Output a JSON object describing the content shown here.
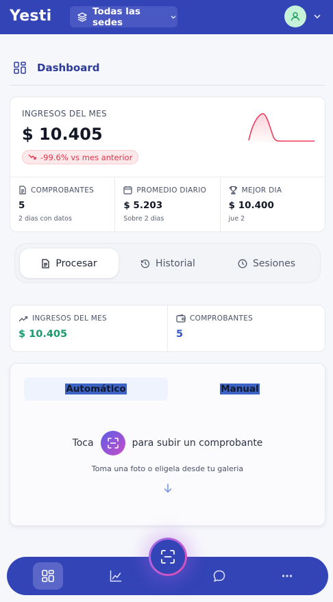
{
  "header": {
    "logo": "Yesti",
    "site_selector": "Todas las sedes"
  },
  "page": {
    "title": "Dashboard"
  },
  "income": {
    "label": "INGRESOS DEL MES",
    "value": "$ 10.405",
    "trend": "-99.6% vs mes anterior",
    "stats": [
      {
        "label": "COMPROBANTES",
        "value": "5",
        "sub": "2 dias con datos",
        "icon": "document-icon"
      },
      {
        "label": "PROMEDIO DIARIO",
        "value": "$ 5.203",
        "sub": "Sobre 2 dias",
        "icon": "calendar-icon"
      },
      {
        "label": "MEJOR DIA",
        "value": "$ 10.400",
        "sub": "jue 2",
        "icon": "trophy-icon"
      }
    ]
  },
  "tabs": [
    {
      "label": "Procesar",
      "icon": "document-icon"
    },
    {
      "label": "Historial",
      "icon": "history-icon"
    },
    {
      "label": "Sesiones",
      "icon": "clock-icon"
    }
  ],
  "mini_stats": [
    {
      "label": "INGRESOS DEL MES",
      "value": "$ 10.405",
      "color": "#1a9a6c",
      "icon": "trending-up-icon"
    },
    {
      "label": "COMPROBANTES",
      "value": "5",
      "color": "#3356c8",
      "icon": "wallet-icon"
    }
  ],
  "upload": {
    "modes": [
      "Automático",
      "Manual"
    ],
    "prompt_before": "Toca",
    "prompt_after": "para subir un comprobante",
    "sub": "Toma una foto o eligela desde tu galeria"
  },
  "colors": {
    "brand": "#3344b6",
    "negative": "#e0324a",
    "positive": "#1a9a6c"
  }
}
